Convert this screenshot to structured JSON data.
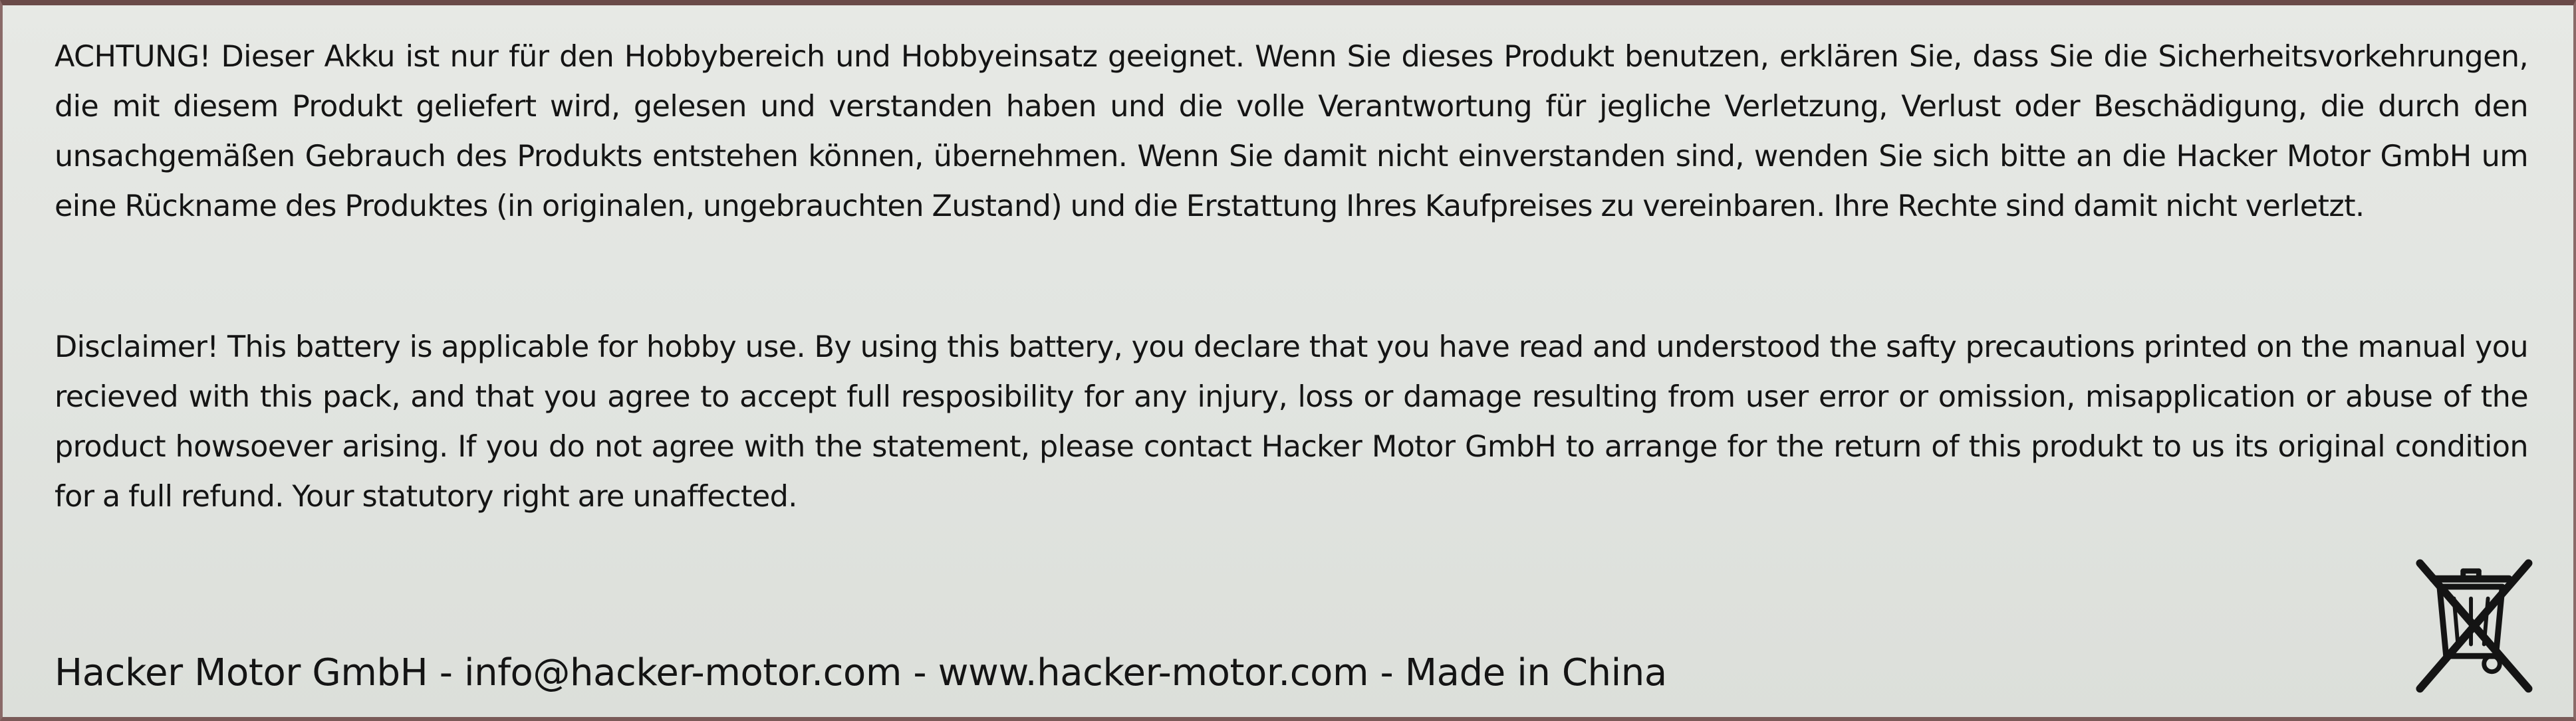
{
  "warning_de": "ACHTUNG! Dieser Akku ist nur für den Hobbybereich und Hobbyeinsatz geeignet. Wenn Sie dieses Produkt benutzen, erklären Sie, dass Sie die Sicherheitsvorkehrungen, die mit diesem Produkt geliefert wird, gelesen und verstanden haben und die volle Verantwortung für jegliche Verletzung, Verlust oder Beschädigung, die durch den unsachgemäßen Gebrauch des Produkts entstehen können, übernehmen. Wenn Sie damit nicht einverstanden sind, wenden Sie sich bitte an die Hacker Motor GmbH um eine Rückname des Produktes (in originalen, ungebrauchten Zustand) und die Erstattung Ihres Kaufpreises zu vereinbaren. Ihre Rechte sind damit nicht verletzt.",
  "disclaimer_en": "Disclaimer! This battery is applicable for hobby use. By using this battery, you declare that you have read and understood the safty precautions printed on the manual you recieved with this pack, and that you agree to accept full resposibility for any injury, loss or damage resulting from user error or omission, misapplication or abuse of the product howsoever arising. If you do not agree with the statement, please contact Hacker Motor GmbH to arrange for the return of this produkt to us its original condition for a full refund. Your statutory right are unaffected.",
  "footer": "Hacker Motor GmbH - info@hacker-motor.com - www.hacker-motor.com - Made in China",
  "icons": {
    "weee": "crossed-out-wheelie-bin-icon"
  },
  "colors": {
    "label_background": "#e3e6e2",
    "text": "#141414"
  }
}
